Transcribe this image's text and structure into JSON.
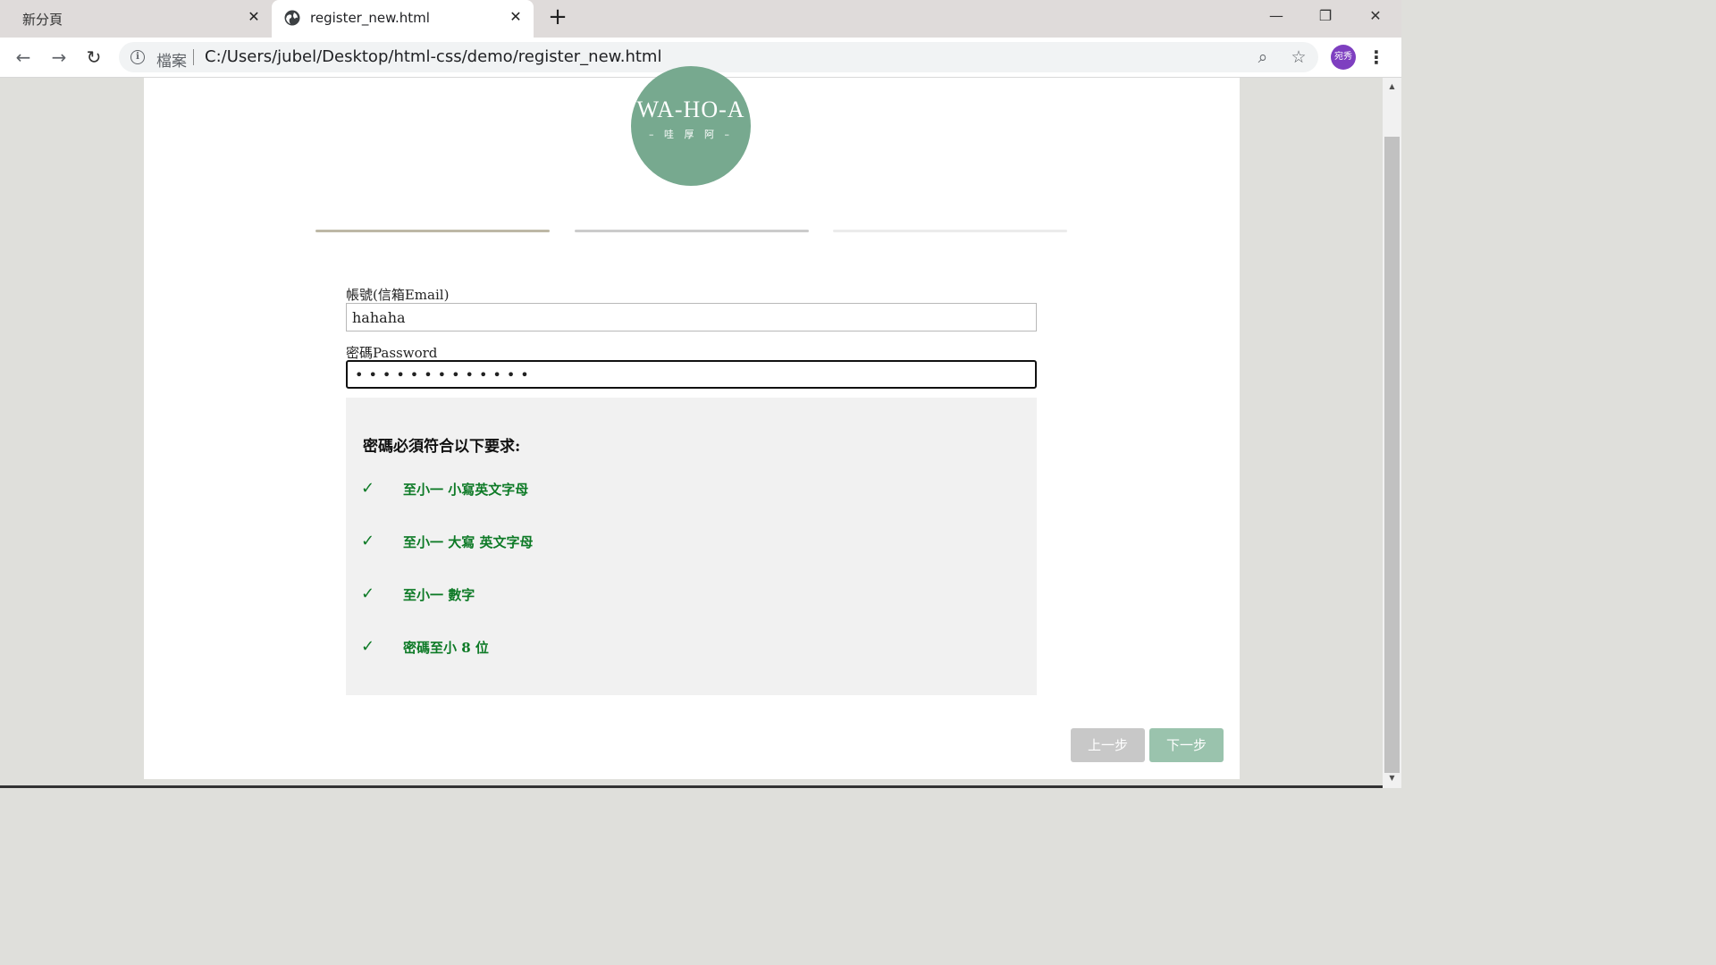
{
  "browser": {
    "tabs": [
      {
        "title": "新分頁"
      },
      {
        "title": "register_new.html"
      }
    ],
    "close_glyph": "✕",
    "new_tab_glyph": "+",
    "window": {
      "minimize": "—",
      "restore": "❐",
      "close": "✕"
    },
    "nav": {
      "back": "←",
      "forward": "→",
      "reload": "↻"
    },
    "address": {
      "info_glyph": "i",
      "scheme_label": "檔案",
      "url": "C:/Users/jubel/Desktop/html-css/demo/register_new.html",
      "zoom_glyph": "⌕",
      "bookmark_glyph": "☆"
    },
    "profile": {
      "initials": "宛秀",
      "color": "#7e3fc0"
    },
    "menu_glyph": "⋮",
    "scroll": {
      "up": "▲",
      "down": "▼"
    }
  },
  "page": {
    "logo": {
      "main": "WA-HO-A",
      "sub": "– 哇 厚 阿 –",
      "color": "#77a98f"
    },
    "progress": {
      "current_step": 1,
      "total_steps": 3,
      "step_colors": [
        "#bdb8a6",
        "#cbcbcb",
        "#ebebeb"
      ]
    },
    "form": {
      "email": {
        "label": "帳號(信箱Email)",
        "value": "hahaha"
      },
      "password": {
        "label": "密碼Password",
        "masked_value": "•••••••••••••"
      }
    },
    "requirements": {
      "title": "密碼必須符合以下要求:",
      "check_glyph": "✓",
      "check_color": "#0d7a26",
      "items": [
        {
          "text": "至小一 小寫英文字母",
          "met": true
        },
        {
          "text": "至小一 大寫 英文字母",
          "met": true
        },
        {
          "text": "至小一 數字",
          "met": true
        },
        {
          "text": "密碼至小 8 位",
          "met": true
        }
      ]
    },
    "buttons": {
      "prev": "上一步",
      "next": "下一步"
    }
  }
}
